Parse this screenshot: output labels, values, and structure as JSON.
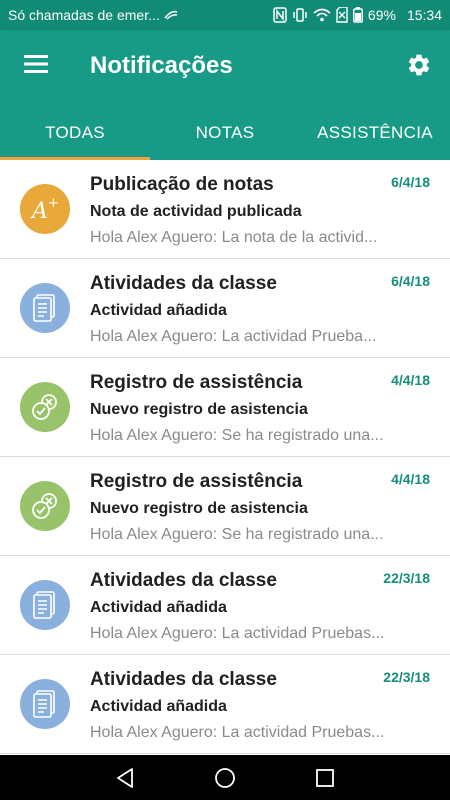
{
  "status_bar": {
    "carrier": "Só chamadas de emer...",
    "battery": "69%",
    "time": "15:34"
  },
  "app_bar": {
    "title": "Notificações",
    "background_color": "#179b86",
    "status_color": "#118a76"
  },
  "tabs": [
    {
      "label": "TODAS",
      "selected": true
    },
    {
      "label": "NOTAS",
      "selected": false
    },
    {
      "label": "ASSISTÊNCIA",
      "selected": false
    }
  ],
  "accent_color": "#f0a13c",
  "notifications": [
    {
      "icon": "grade-icon",
      "icon_color": "#e8a93a",
      "title": "Publicação de notas",
      "subtitle": "Nota de actividad publicada",
      "preview": "Hola Alex Aguero: La nota de la activid...",
      "date": "6/4/18"
    },
    {
      "icon": "document-icon",
      "icon_color": "#8ab0de",
      "title": "Atividades da classe",
      "subtitle": "Actividad añadida",
      "preview": "Hola Alex Aguero: La actividad Prueba...",
      "date": "6/4/18"
    },
    {
      "icon": "attendance-icon",
      "icon_color": "#99c36a",
      "title": "Registro de assistência",
      "subtitle": "Nuevo registro de asistencia",
      "preview": "Hola Alex Aguero: Se ha registrado una...",
      "date": "4/4/18"
    },
    {
      "icon": "attendance-icon",
      "icon_color": "#99c36a",
      "title": "Registro de assistência",
      "subtitle": "Nuevo registro de asistencia",
      "preview": "Hola Alex Aguero: Se ha registrado una...",
      "date": "4/4/18"
    },
    {
      "icon": "document-icon",
      "icon_color": "#8ab0de",
      "title": "Atividades da classe",
      "subtitle": "Actividad añadida",
      "preview": "Hola Alex Aguero: La actividad Pruebas...",
      "date": "22/3/18"
    },
    {
      "icon": "document-icon",
      "icon_color": "#8ab0de",
      "title": "Atividades da classe",
      "subtitle": "Actividad añadida",
      "preview": "Hola Alex Aguero: La actividad Pruebas...",
      "date": "22/3/18"
    }
  ]
}
